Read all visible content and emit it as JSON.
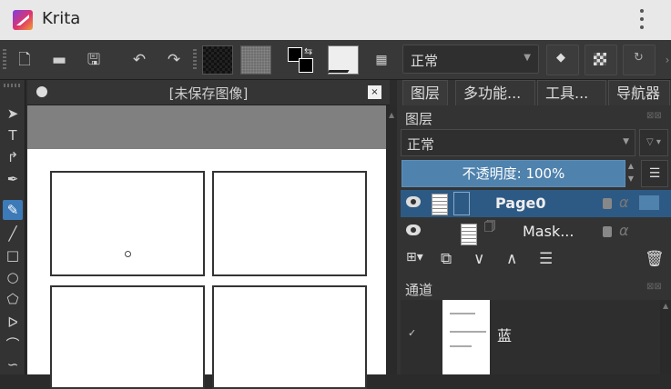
{
  "app": {
    "title": "Krita",
    "logo": "krita-logo-icon"
  },
  "toolbar": {
    "icons": [
      "new-document-icon",
      "open-folder-icon",
      "save-icon",
      "undo-icon",
      "redo-icon",
      "gradient-swatch",
      "pattern-swatch",
      "fg-bg-color-icon",
      "brush-preset-icon",
      "workspace-icon",
      "eraser-icon",
      "alpha-lock-icon",
      "reload-icon"
    ],
    "blend_mode": "正常"
  },
  "document": {
    "title": "[未保存图像]",
    "close_label": "×"
  },
  "dock": {
    "tabs": [
      {
        "label": "图层"
      },
      {
        "label": "多功能..."
      },
      {
        "label": "工具..."
      },
      {
        "label": "导航器"
      }
    ],
    "layers": {
      "title": "图层",
      "blend_mode": "正常",
      "opacity_text": "不透明度: 100%",
      "items": [
        {
          "name": "Page0",
          "selected": true
        },
        {
          "name": "Mask...",
          "selected": false
        }
      ]
    },
    "channels": {
      "title": "通道",
      "items": [
        {
          "name": "蓝",
          "checked": true
        }
      ]
    }
  },
  "tools": [
    "select-shapes-icon",
    "text-icon",
    "edit-shapes-icon",
    "calligraphy-icon",
    "freehand-brush-icon",
    "line-icon",
    "rectangle-icon",
    "ellipse-icon",
    "polygon-icon",
    "polyline-icon",
    "bezier-icon",
    "freehand-path-icon"
  ]
}
